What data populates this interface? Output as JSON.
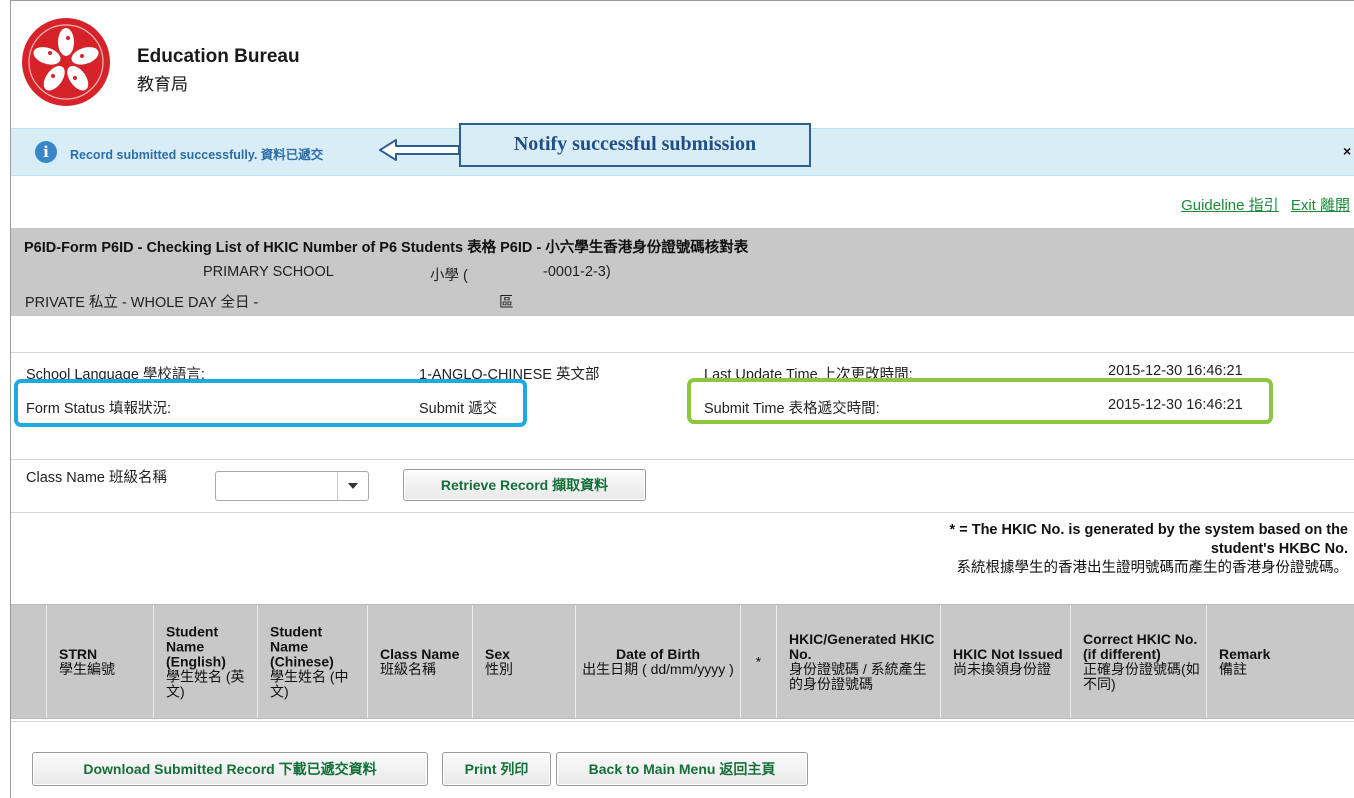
{
  "header": {
    "org_en": "Education Bureau",
    "org_zh": "教育局"
  },
  "notification": {
    "message": "Record submitted successfully. 資料已遞交",
    "callout": "Notify successful submission",
    "close_label": "×"
  },
  "links": {
    "guideline": "Guideline 指引",
    "exit": "Exit 離開"
  },
  "form_panel": {
    "title": "P6ID-Form P6ID - Checking List of HKIC Number of P6 Students 表格 P6ID - 小六學生香港身份證號碼核對表",
    "school_name": "PRIMARY SCHOOL",
    "school_name_zh": "小學 (",
    "school_code": "-0001-2-3)",
    "school_type": "PRIVATE 私立 - WHOLE DAY 全日 -",
    "district": "區"
  },
  "school_info": {
    "language_label": "School Language 學校語言:",
    "language_value": "1-ANGLO-CHINESE 英文部",
    "last_update_label": "Last Update Time 上次更改時間:",
    "last_update_value": "2015-12-30 16:46:21",
    "status_label": "Form Status 填報狀況:",
    "status_value": "Submit 遞交",
    "submit_time_label": "Submit Time 表格遞交時間:",
    "submit_time_value": "2015-12-30 16:46:21"
  },
  "class_filter": {
    "label": "Class Name 班級名稱",
    "selected": "",
    "retrieve_button": "Retrieve Record 擷取資料"
  },
  "note": {
    "line1": "* = The HKIC No. is generated by the system based on the",
    "line2": "student's HKBC No.",
    "line3": "系統根據學生的香港出生證明號碼而產生的香港身份證號碼。"
  },
  "table_headers": [
    {
      "en": "STRN",
      "zh": "學生編號"
    },
    {
      "en": "Student Name (English)",
      "zh": "學生姓名 (英文)"
    },
    {
      "en": "Student Name (Chinese)",
      "zh": "學生姓名 (中文)"
    },
    {
      "en": "Class Name",
      "zh": "班級名稱"
    },
    {
      "en": "Sex",
      "zh": "性別"
    },
    {
      "en": "Date of Birth",
      "zh": "出生日期 ( dd/mm/yyyy )"
    },
    {
      "en": "",
      "zh": "*"
    },
    {
      "en": "HKIC/Generated HKIC No.",
      "zh": "身份證號碼 / 系統產生的身份證號碼"
    },
    {
      "en": "HKIC Not Issued",
      "zh": "尚未換領身份證"
    },
    {
      "en": "Correct HKIC No. (if different)",
      "zh": "正確身份證號碼(如不同)"
    },
    {
      "en": "Remark",
      "zh": "備註"
    }
  ],
  "footer_buttons": {
    "download": "Download Submitted Record 下載已遞交資料",
    "print": "Print 列印",
    "back": "Back to Main Menu 返回主頁"
  },
  "colors": {
    "link_green": "#1b8a3a",
    "notify_bg": "#d9edf7",
    "highlight_blue": "#1fa9e1",
    "highlight_green": "#8dc63f",
    "panel_grey": "#c8c8c8"
  }
}
